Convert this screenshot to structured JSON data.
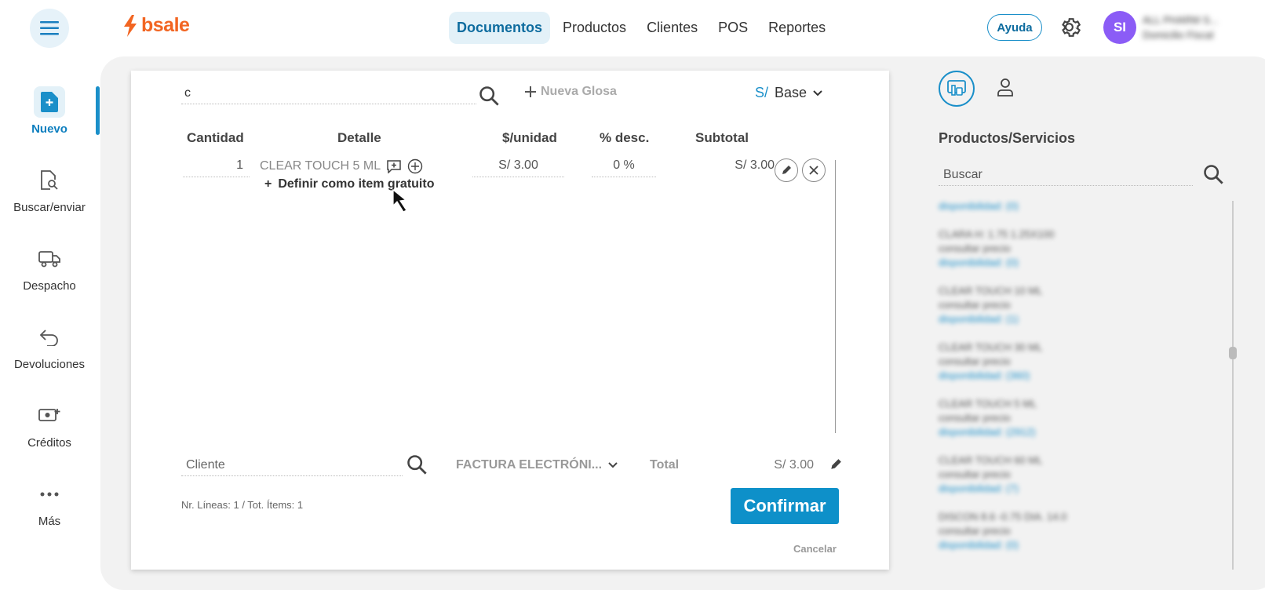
{
  "topbar": {
    "brand": "bsale",
    "nav": [
      "Documentos",
      "Productos",
      "Clientes",
      "POS",
      "Reportes"
    ],
    "active_nav": "Documentos",
    "help_label": "Ayuda",
    "avatar_initials": "SI",
    "account_name": "ALL PHARM S...",
    "account_sub": "Domicilio Fiscal"
  },
  "sidebar": {
    "items": [
      {
        "label": "Nuevo",
        "icon": "new-document-icon"
      },
      {
        "label": "Buscar/enviar",
        "icon": "document-search-icon"
      },
      {
        "label": "Despacho",
        "icon": "truck-icon"
      },
      {
        "label": "Devoluciones",
        "icon": "return-arrow-icon"
      },
      {
        "label": "Créditos",
        "icon": "money-plus-icon"
      },
      {
        "label": "Más",
        "icon": "more-dots-icon"
      }
    ]
  },
  "document": {
    "code_value": "c",
    "new_gloss_label": "Nueva Glosa",
    "currency_symbol": "S/",
    "price_list": "Base",
    "columns": {
      "qty": "Cantidad",
      "detail": "Detalle",
      "unit": "$/unidad",
      "discount": "% desc.",
      "subtotal": "Subtotal"
    },
    "line": {
      "qty": "1",
      "detail": "CLEAR TOUCH 5 ML",
      "unit_price": "S/ 3.00",
      "discount": "0 %",
      "subtotal": "S/ 3.00",
      "free_item_label": "Definir como item gratuito"
    },
    "client_placeholder": "Cliente",
    "doc_type": "FACTURA ELECTRÓNI...",
    "total_label": "Total",
    "total_value": "S/ 3.00",
    "counts": "Nr. Líneas: 1 / Tot. Ítems: 1",
    "confirm_label": "Confirmar",
    "cancel_label": "Cancelar"
  },
  "right_panel": {
    "title": "Productos/Servicios",
    "search_placeholder": "Buscar",
    "items": [
      {
        "lines": [],
        "avail": "disponibilidad: (0)"
      },
      {
        "lines": [
          "CLARA H: 1.75 1.25X100",
          "consultar precio"
        ],
        "avail": "disponibilidad: (0)"
      },
      {
        "lines": [
          "CLEAR TOUCH 10 ML",
          "consultar precio"
        ],
        "avail": "disponibilidad: (1)"
      },
      {
        "lines": [
          "CLEAR TOUCH 30 ML",
          "consultar precio"
        ],
        "avail": "disponibilidad: (360)"
      },
      {
        "lines": [
          "CLEAR TOUCH 5 ML",
          "consultar precio"
        ],
        "avail": "disponibilidad: (2912)"
      },
      {
        "lines": [
          "CLEAR TOUCH 60 ML",
          "consultar precio"
        ],
        "avail": "disponibilidad: (7)"
      },
      {
        "lines": [
          "DISCON 8.6 -0.75 DIA. 14.0",
          "consultar precio"
        ],
        "avail": "disponibilidad: (0)"
      }
    ]
  },
  "colors": {
    "brand": "#f26522",
    "accent": "#0e90c9",
    "avatar": "#8b5cf6"
  }
}
